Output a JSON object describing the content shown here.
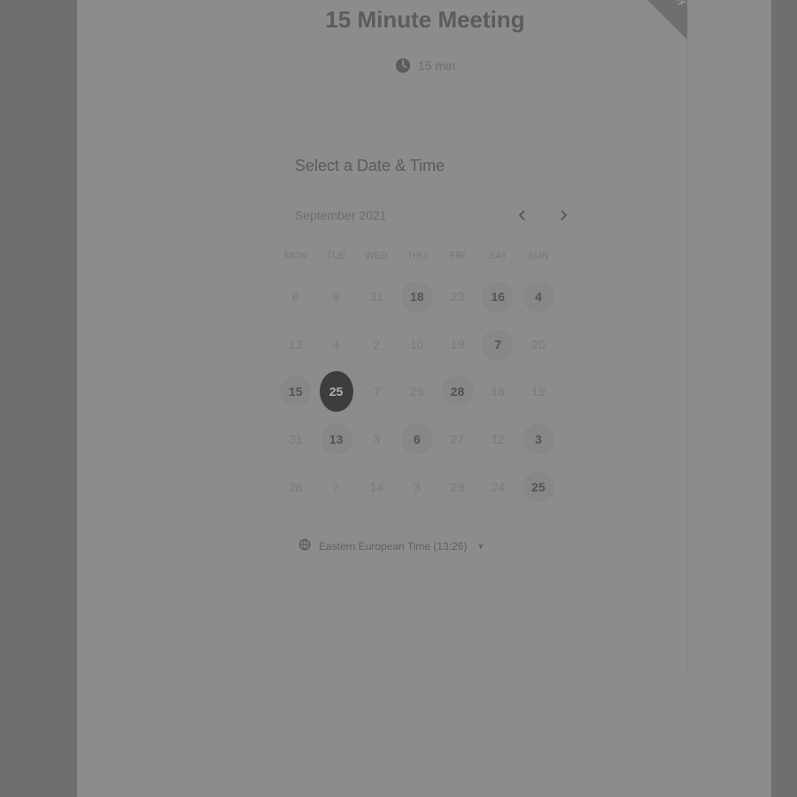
{
  "ribbon": {
    "text": "ly"
  },
  "event": {
    "title": "15 Minute Meeting",
    "duration": "15 min"
  },
  "scheduler": {
    "heading": "Select a Date & Time",
    "month": "September 2021",
    "weekdays": [
      "MON",
      "TUE",
      "WED",
      "THU",
      "FRI",
      "SAT",
      "SUN"
    ],
    "days": [
      {
        "label": "6",
        "state": "unavailable"
      },
      {
        "label": "8",
        "state": "unavailable"
      },
      {
        "label": "31",
        "state": "unavailable"
      },
      {
        "label": "18",
        "state": "available"
      },
      {
        "label": "23",
        "state": "unavailable"
      },
      {
        "label": "16",
        "state": "available"
      },
      {
        "label": "4",
        "state": "available"
      },
      {
        "label": "13",
        "state": "unavailable"
      },
      {
        "label": "4",
        "state": "unavailable"
      },
      {
        "label": "2",
        "state": "unavailable"
      },
      {
        "label": "10",
        "state": "unavailable"
      },
      {
        "label": "19",
        "state": "unavailable"
      },
      {
        "label": "7",
        "state": "available"
      },
      {
        "label": "20",
        "state": "unavailable"
      },
      {
        "label": "15",
        "state": "available"
      },
      {
        "label": "25",
        "state": "selected"
      },
      {
        "label": "7",
        "state": "unavailable"
      },
      {
        "label": "29",
        "state": "unavailable"
      },
      {
        "label": "28",
        "state": "available"
      },
      {
        "label": "18",
        "state": "unavailable"
      },
      {
        "label": "19",
        "state": "unavailable"
      },
      {
        "label": "31",
        "state": "unavailable"
      },
      {
        "label": "13",
        "state": "available"
      },
      {
        "label": "3",
        "state": "unavailable"
      },
      {
        "label": "6",
        "state": "available"
      },
      {
        "label": "27",
        "state": "unavailable"
      },
      {
        "label": "12",
        "state": "unavailable"
      },
      {
        "label": "3",
        "state": "available"
      },
      {
        "label": "28",
        "state": "unavailable"
      },
      {
        "label": "7",
        "state": "unavailable"
      },
      {
        "label": "14",
        "state": "unavailable"
      },
      {
        "label": "3",
        "state": "unavailable"
      },
      {
        "label": "29",
        "state": "unavailable"
      },
      {
        "label": "24",
        "state": "unavailable"
      },
      {
        "label": "25",
        "state": "available"
      }
    ],
    "timezone": "Eastern European Time (13:26)"
  },
  "icons": {
    "clock": "clock-icon",
    "prev": "chevron-left-icon",
    "next": "chevron-right-icon",
    "globe": "globe-icon",
    "caret": "caret-down-icon"
  },
  "colors": {
    "overlay": "#6f6f6f",
    "selected": "#3d3d3d"
  }
}
